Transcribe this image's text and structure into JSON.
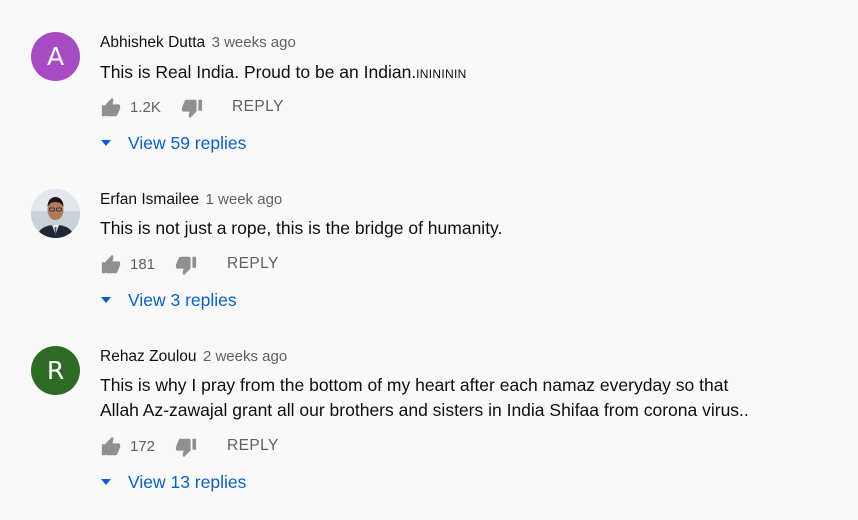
{
  "colors": {
    "avatar_a": "#a64bc4",
    "avatar_r": "#2e6b24",
    "link": "#065fd4",
    "meta": "#606060",
    "background": "#f9f9f9"
  },
  "comments": [
    {
      "avatar_letter": "A",
      "author": "Abhishek Dutta",
      "time": "3 weeks ago",
      "text_main": "This is Real India. Proud to be an Indian.",
      "text_suffix": "ININININ",
      "likes": "1.2K",
      "reply_label": "REPLY",
      "view_replies": "View 59 replies"
    },
    {
      "avatar_letter": "",
      "author": "Erfan Ismailee",
      "time": "1 week ago",
      "text_main": "This is not just a rope, this is the bridge of humanity.",
      "likes": "181",
      "reply_label": "REPLY",
      "view_replies": "View 3 replies"
    },
    {
      "avatar_letter": "R",
      "author": "Rehaz Zoulou",
      "time": "2 weeks ago",
      "text_line1": "This is why I pray from the bottom of my heart after each namaz everyday so that",
      "text_line2": "Allah Az-zawajal grant all our brothers and sisters in India Shifaa from corona virus..",
      "likes": "172",
      "reply_label": "REPLY",
      "view_replies": "View 13 replies"
    }
  ]
}
